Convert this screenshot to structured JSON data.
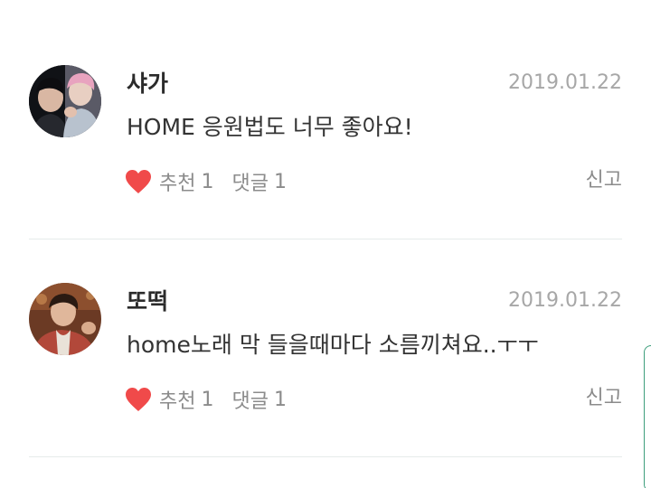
{
  "comments": [
    {
      "nickname": "샤가",
      "date": "2019.01.22",
      "text": "HOME 응원법도 너무 좋아요!",
      "like_label": "추천",
      "like_count": "1",
      "reply_label": "댓글",
      "reply_count": "1",
      "report_label": "신고",
      "avatar": "avatar-two-people"
    },
    {
      "nickname": "또떡",
      "date": "2019.01.22",
      "text": "home노래 막 들을때마다 소름끼쳐요..ㅜㅜ",
      "like_label": "추천",
      "like_count": "1",
      "reply_label": "댓글",
      "reply_count": "1",
      "report_label": "신고",
      "avatar": "avatar-person"
    }
  ],
  "icons": {
    "like": "heart-icon"
  },
  "colors": {
    "heart": "#f04a4a",
    "date": "#a7a7a7",
    "action": "#8b8b8b",
    "divider": "#e6ebea",
    "scrollbar": "#3d9e7c"
  }
}
